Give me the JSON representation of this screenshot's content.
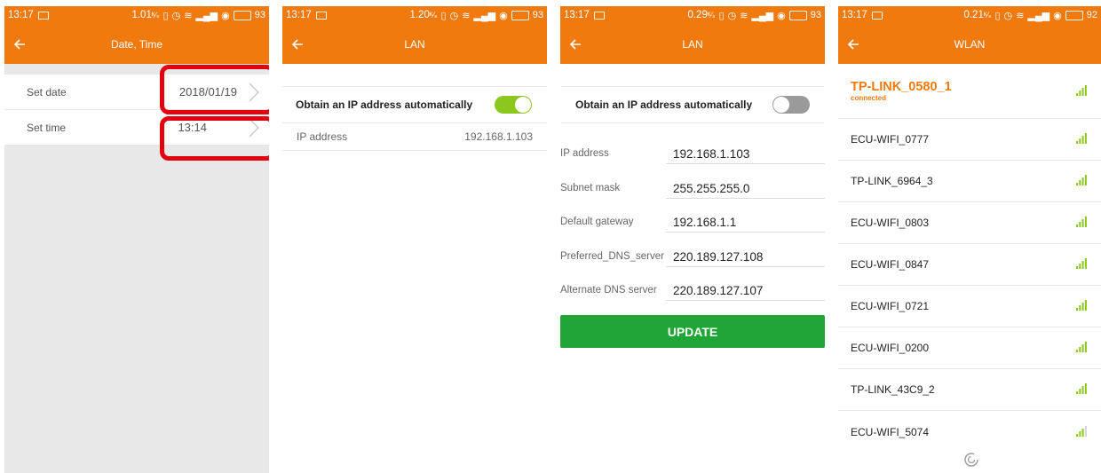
{
  "status": {
    "p1": {
      "time": "13:17",
      "speed": "1.01",
      "battery": "93"
    },
    "p2": {
      "time": "13:17",
      "speed": "1.20",
      "battery": "93"
    },
    "p3": {
      "time": "13:17",
      "speed": "0.29",
      "battery": "93"
    },
    "p4": {
      "time": "13:17",
      "speed": "0.21",
      "battery": "92"
    },
    "speed_unit": "ᴷ⁄ₛ"
  },
  "datetime": {
    "title": "Date, Time",
    "rows": [
      {
        "label": "Set date",
        "value": "2018/01/19"
      },
      {
        "label": "Set time",
        "value": "13:14"
      }
    ]
  },
  "lan_auto": {
    "title": "LAN",
    "toggle_label": "Obtain an IP address automatically",
    "toggle_on": true,
    "ip_label": "IP address",
    "ip_value": "192.168.1.103"
  },
  "lan_manual": {
    "title": "LAN",
    "toggle_label": "Obtain an IP address automatically",
    "toggle_on": false,
    "fields": [
      {
        "label": "IP address",
        "value": "192.168.1.103"
      },
      {
        "label": "Subnet mask",
        "value": "255.255.255.0"
      },
      {
        "label": "Default gateway",
        "value": "192.168.1.1"
      },
      {
        "label": "Preferred_DNS_server",
        "value": "220.189.127.108"
      },
      {
        "label": "Alternate DNS server",
        "value": "220.189.127.107"
      }
    ],
    "update_label": "UPDATE"
  },
  "wlan": {
    "title": "WLAN",
    "connected": {
      "ssid": "TP-LINK_0580_1",
      "status": "connected"
    },
    "networks": [
      "ECU-WIFI_0777",
      "TP-LINK_6964_3",
      "ECU-WIFI_0803",
      "ECU-WIFI_0847",
      "ECU-WIFI_0721",
      "ECU-WIFI_0200",
      "TP-LINK_43C9_2",
      "ECU-WIFI_5074"
    ]
  },
  "colors": {
    "accent": "#f07a0e",
    "highlight": "#e3000f",
    "toggle_on": "#8cc71e",
    "update": "#20a637",
    "signal": "#8cc71e"
  },
  "icons": [
    "back-arrow-icon",
    "chevron-right-icon",
    "wifi-signal-icon",
    "loading-spinner-icon",
    "message-icon",
    "battery-icon"
  ]
}
